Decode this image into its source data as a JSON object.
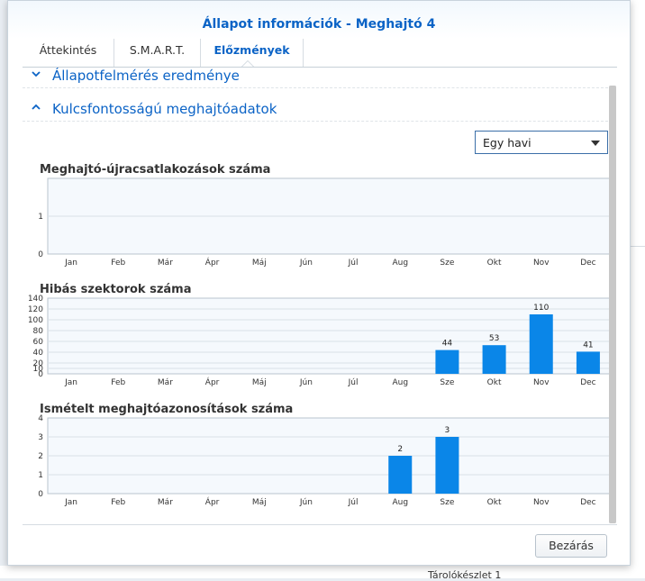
{
  "dialog": {
    "title": "Állapot információk - Meghajtó 4",
    "tabs": [
      {
        "label": "Áttekintés"
      },
      {
        "label": "S.M.A.R.T."
      },
      {
        "label": "Előzmények"
      }
    ],
    "sections": [
      {
        "label": "Állapotfelmérés eredménye",
        "expanded": false
      },
      {
        "label": "Kulcsfontosságú meghajtóadatok",
        "expanded": true
      }
    ],
    "period_select": {
      "value": "Egy havi"
    },
    "close_label": "Bezárás"
  },
  "background": {
    "partial_text": "Tárolókészlet 1"
  },
  "colors": {
    "accent": "#0b63c6",
    "bar": "#0a86e8",
    "plot_bg": "#f5f9fd"
  },
  "chart_data": [
    {
      "type": "bar",
      "title": "Meghajtó-újracsatlakozások száma",
      "categories": [
        "Jan",
        "Feb",
        "Már",
        "Ápr",
        "Máj",
        "Jún",
        "Júl",
        "Aug",
        "Sze",
        "Okt",
        "Nov",
        "Dec"
      ],
      "values": [
        0,
        0,
        0,
        0,
        0,
        0,
        0,
        0,
        0,
        0,
        0,
        0
      ],
      "yticks": [
        0,
        1
      ],
      "ylim": [
        0,
        2
      ],
      "grid": true
    },
    {
      "type": "bar",
      "title": "Hibás szektorok száma",
      "categories": [
        "Jan",
        "Feb",
        "Már",
        "Ápr",
        "Máj",
        "Jún",
        "Júl",
        "Aug",
        "Sze",
        "Okt",
        "Nov",
        "Dec"
      ],
      "values": [
        0,
        0,
        0,
        0,
        0,
        0,
        0,
        0,
        44,
        53,
        110,
        41
      ],
      "yticks": [
        0,
        10,
        20,
        40,
        60,
        80,
        100,
        120,
        140
      ],
      "ylim": [
        0,
        140
      ],
      "grid": true
    },
    {
      "type": "bar",
      "title": "Ismételt meghajtóazonosítások száma",
      "categories": [
        "Jan",
        "Feb",
        "Már",
        "Ápr",
        "Máj",
        "Jún",
        "Júl",
        "Aug",
        "Sze",
        "Okt",
        "Nov",
        "Dec"
      ],
      "values": [
        0,
        0,
        0,
        0,
        0,
        0,
        0,
        2,
        3,
        0,
        0,
        0
      ],
      "yticks": [
        0,
        1,
        2,
        3,
        4
      ],
      "ylim": [
        0,
        4
      ],
      "grid": true
    }
  ]
}
